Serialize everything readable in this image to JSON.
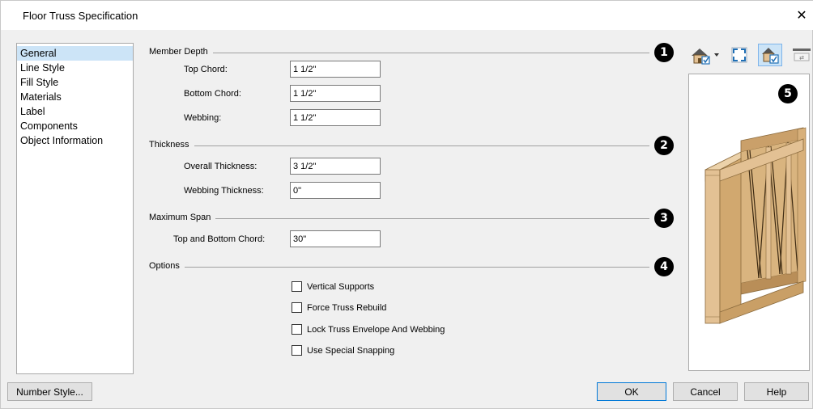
{
  "window": {
    "title": "Floor Truss Specification",
    "close_glyph": "✕"
  },
  "nav": {
    "items": [
      {
        "label": "General",
        "selected": true
      },
      {
        "label": "Line Style"
      },
      {
        "label": "Fill Style"
      },
      {
        "label": "Materials"
      },
      {
        "label": "Label"
      },
      {
        "label": "Components"
      },
      {
        "label": "Object Information"
      }
    ]
  },
  "sections": {
    "member_depth": {
      "label": "Member Depth",
      "badge": "1"
    },
    "thickness": {
      "label": "Thickness",
      "badge": "2"
    },
    "maximum_span": {
      "label": "Maximum Span",
      "badge": "3"
    },
    "options": {
      "label": "Options",
      "badge": "4"
    },
    "preview": {
      "badge": "5"
    }
  },
  "fields": {
    "top_chord": {
      "label": "Top Chord:",
      "value": "1 1/2\""
    },
    "bottom_chord": {
      "label": "Bottom Chord:",
      "value": "1 1/2\""
    },
    "webbing": {
      "label": "Webbing:",
      "value": "1 1/2\""
    },
    "overall_thickness": {
      "label": "Overall Thickness:",
      "value": "3 1/2\""
    },
    "webbing_thickness": {
      "label": "Webbing Thickness:",
      "value": "0\""
    },
    "top_bottom_chord": {
      "label": "Top and Bottom Chord:",
      "value": "30\""
    }
  },
  "options": [
    {
      "label": "Vertical Supports",
      "checked": false
    },
    {
      "label": "Force Truss Rebuild",
      "checked": false
    },
    {
      "label": "Lock Truss Envelope And Webbing",
      "checked": false
    },
    {
      "label": "Use Special Snapping",
      "checked": false
    }
  ],
  "buttons": {
    "number_style": "Number Style...",
    "ok": "OK",
    "cancel": "Cancel",
    "help": "Help"
  },
  "colors": {
    "selection": "#cce4f7",
    "wood": "#e3c194",
    "ok_border": "#0078d7"
  },
  "icons": [
    "camera-view-icon",
    "fill-window-icon",
    "3d-preview-icon",
    "swap-icon"
  ]
}
